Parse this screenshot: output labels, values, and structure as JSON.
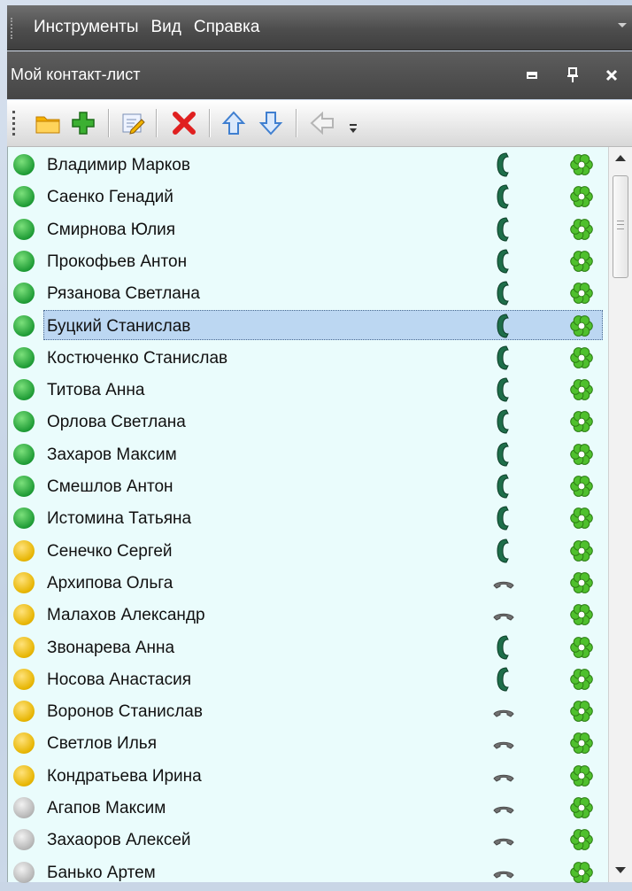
{
  "menu": {
    "items": [
      "Инструменты",
      "Вид",
      "Справка"
    ]
  },
  "panel": {
    "title": "Мой контакт-лист"
  },
  "toolbar": {
    "icons": [
      "folder-icon",
      "add-icon",
      "edit-icon",
      "delete-icon",
      "arrow-up-icon",
      "arrow-down-icon",
      "arrow-left-icon",
      "toolbar-overflow-icon"
    ]
  },
  "colors": {
    "online": "#1e9b35",
    "away": "#e6b400",
    "offline": "#b5b5b5",
    "selection": "#bcd7f2",
    "list_background": "#eafcfc"
  },
  "contacts": [
    {
      "name": "Владимир Марков",
      "status": "online",
      "phone": "active"
    },
    {
      "name": "Саенко Генадий",
      "status": "online",
      "phone": "active"
    },
    {
      "name": "Смирнова Юлия",
      "status": "online",
      "phone": "active"
    },
    {
      "name": "Прокофьев Антон",
      "status": "online",
      "phone": "active"
    },
    {
      "name": "Рязанова Светлана",
      "status": "online",
      "phone": "active"
    },
    {
      "name": "Буцкий Станислав",
      "status": "online",
      "phone": "active",
      "selected": true
    },
    {
      "name": "Костюченко Станислав",
      "status": "online",
      "phone": "active"
    },
    {
      "name": "Титова Анна",
      "status": "online",
      "phone": "active"
    },
    {
      "name": "Орлова Светлана",
      "status": "online",
      "phone": "active"
    },
    {
      "name": "Захаров Максим",
      "status": "online",
      "phone": "active"
    },
    {
      "name": "Смешлов Антон",
      "status": "online",
      "phone": "active"
    },
    {
      "name": "Истомина Татьяна",
      "status": "online",
      "phone": "active"
    },
    {
      "name": "Сенечко Сергей",
      "status": "away",
      "phone": "active"
    },
    {
      "name": "Архипова Ольга",
      "status": "away",
      "phone": "hungup"
    },
    {
      "name": "Малахов Александр",
      "status": "away",
      "phone": "hungup"
    },
    {
      "name": "Звонарева Анна",
      "status": "away",
      "phone": "active"
    },
    {
      "name": "Носова Анастасия",
      "status": "away",
      "phone": "active"
    },
    {
      "name": "Воронов Станислав",
      "status": "away",
      "phone": "hungup"
    },
    {
      "name": "Светлов Илья",
      "status": "away",
      "phone": "hungup"
    },
    {
      "name": "Кондратьева Ирина",
      "status": "away",
      "phone": "hungup"
    },
    {
      "name": "Агапов Максим",
      "status": "offline",
      "phone": "hungup"
    },
    {
      "name": "Захаоров Алексей",
      "status": "offline",
      "phone": "hungup"
    },
    {
      "name": "Банько Артем",
      "status": "offline",
      "phone": "hungup"
    }
  ]
}
